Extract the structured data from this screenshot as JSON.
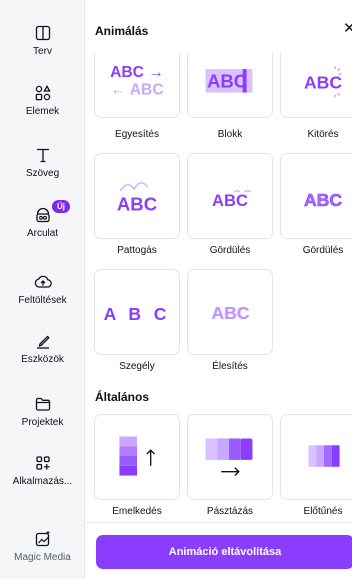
{
  "sidebar": {
    "items": [
      {
        "label": "Terv",
        "icon": "layout-icon"
      },
      {
        "label": "Elemek",
        "icon": "shapes-icon"
      },
      {
        "label": "Szöveg",
        "icon": "text-icon"
      },
      {
        "label": "Arculat",
        "icon": "brand-icon",
        "badge": "Új"
      },
      {
        "label": "Feltöltések",
        "icon": "upload-icon"
      },
      {
        "label": "Eszközök",
        "icon": "draw-icon"
      },
      {
        "label": "Projektek",
        "icon": "folder-icon"
      },
      {
        "label": "Alkalmazás...",
        "icon": "apps-icon"
      },
      {
        "label": "Magic Media",
        "icon": "magic-media-icon"
      }
    ]
  },
  "panel": {
    "title": "Animálás",
    "close_icon": "close-icon",
    "sections": [
      {
        "title": "",
        "tiles": [
          {
            "label": "Egyesítés",
            "art": "ABC →\n← ABC"
          },
          {
            "label": "Blokk",
            "art": "ABC"
          },
          {
            "label": "Kitörés",
            "art": "ABC"
          },
          {
            "label": "Pattogás",
            "art": "ABC"
          },
          {
            "label": "Gördülés",
            "art": "ABC"
          },
          {
            "label": "Gördülés",
            "art": "ABC"
          },
          {
            "label": "Szegély",
            "art": "A B C"
          },
          {
            "label": "Élesítés",
            "art": "ABC"
          }
        ]
      },
      {
        "title": "Általános",
        "tiles": [
          {
            "label": "Emelkedés",
            "art": "↑"
          },
          {
            "label": "Pásztázás",
            "art": "→"
          },
          {
            "label": "Előtűnés",
            "art": ""
          }
        ]
      }
    ],
    "remove_button": "Animáció eltávolítása"
  },
  "colors": {
    "accent": "#8b3dff",
    "accent_light": "#c9a7ff",
    "rail_bg": "#f5f6f8",
    "border": "#e3e5e8"
  }
}
